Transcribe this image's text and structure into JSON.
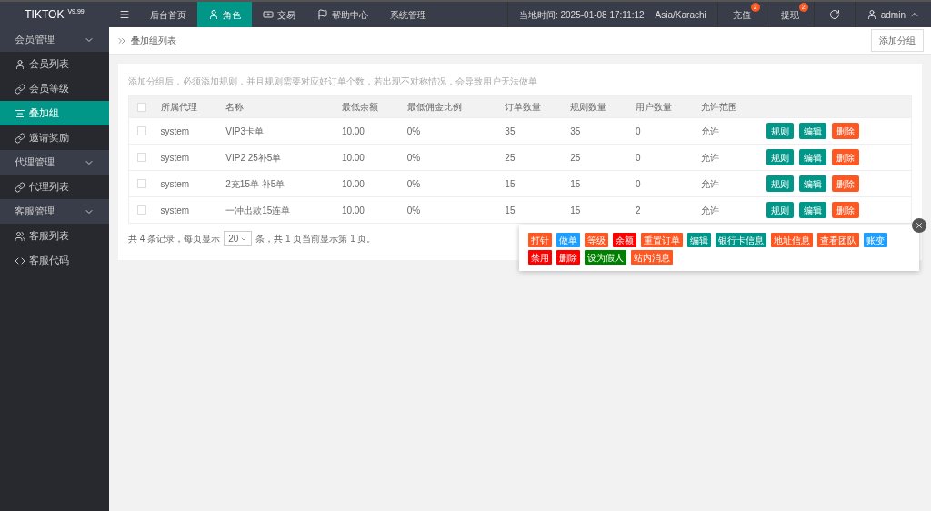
{
  "logo": {
    "name": "TIKTOK",
    "version": "V9.99"
  },
  "topnav": [
    {
      "label": "后台首页",
      "kind": "plain",
      "selected": false
    },
    {
      "label": "角色",
      "kind": "user",
      "selected": true
    },
    {
      "label": "交易",
      "kind": "money",
      "selected": false
    },
    {
      "label": "帮助中心",
      "kind": "flag",
      "selected": false
    },
    {
      "label": "系统管理",
      "kind": "plain",
      "selected": false
    }
  ],
  "status": {
    "time_label": "当地时间: 2025-01-08 17:11:12",
    "timezone": "Asia/Karachi"
  },
  "top_actions": [
    {
      "label": "充值",
      "badge": "2"
    },
    {
      "label": "提现",
      "badge": "2"
    }
  ],
  "user": {
    "name": "admin"
  },
  "sidebar": [
    {
      "label": "会员管理",
      "expanded": true,
      "children": [
        {
          "label": "会员列表",
          "kind": "user",
          "selected": false
        },
        {
          "label": "会员等级",
          "kind": "link",
          "selected": false
        },
        {
          "label": "叠加组",
          "kind": "list",
          "selected": true
        },
        {
          "label": "邀请奖励",
          "kind": "link",
          "selected": false
        }
      ]
    },
    {
      "label": "代理管理",
      "expanded": true,
      "children": [
        {
          "label": "代理列表",
          "kind": "link",
          "selected": false
        }
      ]
    },
    {
      "label": "客服管理",
      "expanded": true,
      "children": [
        {
          "label": "客服列表",
          "kind": "users",
          "selected": false
        },
        {
          "label": "客服代码",
          "kind": "code",
          "selected": false
        }
      ]
    }
  ],
  "breadcrumb": "叠加组列表",
  "add_button": "添加分组",
  "notice": "添加分组后，必须添加规则，并且规则需要对应好订单个数，若出现不对称情况，会导致用户无法做单",
  "table": {
    "all_checked": false,
    "columns": [
      "所属代理",
      "名称",
      "最低余额",
      "最低佣金比例",
      "订单数量",
      "规则数量",
      "用户数量",
      "允许范围"
    ],
    "rows": [
      {
        "checked": false,
        "cells": [
          "system",
          "VIP3卡单",
          "10.00",
          "0%",
          "35",
          "35",
          "0",
          "允许"
        ],
        "actions": [
          "规则",
          "编辑",
          "删除"
        ]
      },
      {
        "checked": false,
        "cells": [
          "system",
          "VIP2 25补5单",
          "10.00",
          "0%",
          "25",
          "25",
          "0",
          "允许"
        ],
        "actions": [
          "规则",
          "编辑",
          "删除"
        ]
      },
      {
        "checked": false,
        "cells": [
          "system",
          "2充15单 补5单",
          "10.00",
          "0%",
          "15",
          "15",
          "0",
          "允许"
        ],
        "actions": [
          "规则",
          "编辑",
          "删除"
        ]
      },
      {
        "checked": false,
        "cells": [
          "system",
          "一冲出款15连单",
          "10.00",
          "0%",
          "15",
          "15",
          "2",
          "允许"
        ],
        "actions": [
          "规则",
          "编辑",
          "删除"
        ]
      }
    ]
  },
  "pagination": {
    "before": "共 4 条记录，每页显示",
    "page_size": "20",
    "after": "条，共 1 页当前显示第 1 页。"
  },
  "popup": {
    "buttons": [
      {
        "label": "打针",
        "color": "#ff5722"
      },
      {
        "label": "做单",
        "color": "#1e9fff"
      },
      {
        "label": "等级",
        "color": "#ff5722"
      },
      {
        "label": "余额",
        "color": "#ff0000"
      },
      {
        "label": "重置订单",
        "color": "#ff5722"
      },
      {
        "label": "编辑",
        "color": "#009688"
      },
      {
        "label": "银行卡信息",
        "color": "#009688"
      },
      {
        "label": "地址信息",
        "color": "#ff5722"
      },
      {
        "label": "查看团队",
        "color": "#ff5722"
      },
      {
        "label": "账变",
        "color": "#1e9fff"
      },
      {
        "label": "禁用",
        "color": "#ff0000"
      },
      {
        "label": "删除",
        "color": "#ff0000"
      },
      {
        "label": "设为假人",
        "color": "#008000"
      },
      {
        "label": "站内消息",
        "color": "#ff5722"
      }
    ]
  }
}
